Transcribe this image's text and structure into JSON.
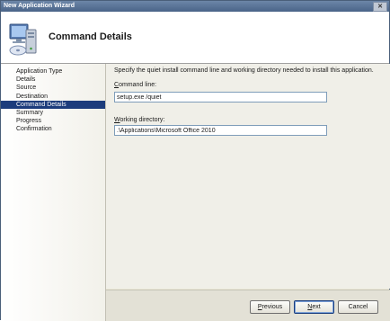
{
  "window": {
    "title": "New Application Wizard",
    "close_label": "✕"
  },
  "header": {
    "title": "Command Details",
    "icon": "computer-install-icon"
  },
  "sidebar": {
    "items": [
      {
        "label": "Application Type",
        "active": false
      },
      {
        "label": "Details",
        "active": false
      },
      {
        "label": "Source",
        "active": false
      },
      {
        "label": "Destination",
        "active": false
      },
      {
        "label": "Command Details",
        "active": true
      },
      {
        "label": "Summary",
        "active": false
      },
      {
        "label": "Progress",
        "active": false
      },
      {
        "label": "Confirmation",
        "active": false
      }
    ]
  },
  "main": {
    "instruction": "Specify the quiet install command line and working directory needed to install this application.",
    "command_line": {
      "label_mnemonic": "C",
      "label_rest": "ommand line:",
      "value": "setup.exe /quiet"
    },
    "working_directory": {
      "label_mnemonic": "W",
      "label_rest": "orking directory:",
      "value": ".\\Applications\\Microsoft Office 2010"
    }
  },
  "buttons": {
    "previous": {
      "mnemonic": "P",
      "rest": "revious"
    },
    "next": {
      "mnemonic": "N",
      "rest": "ext"
    },
    "cancel": {
      "label": "Cancel"
    }
  },
  "colors": {
    "selection": "#1c3c7c",
    "titlebar": "#4a6488",
    "input_border": "#7f9db9"
  }
}
